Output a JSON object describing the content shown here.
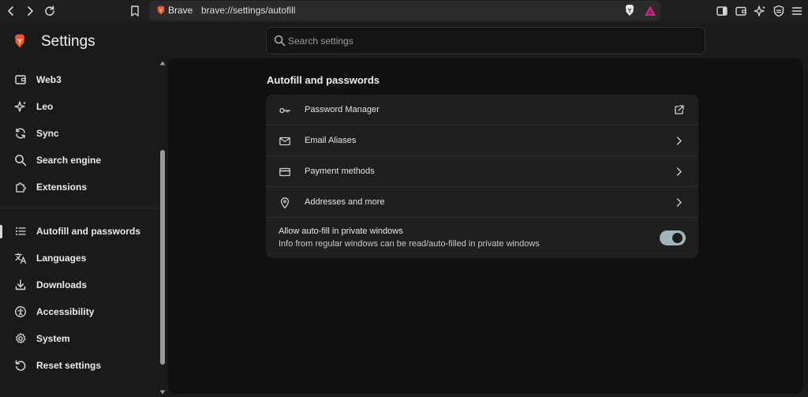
{
  "browser": {
    "site_name": "Brave",
    "url": "brave://settings/autofill"
  },
  "app": {
    "title": "Settings"
  },
  "search": {
    "placeholder": "Search settings",
    "value": ""
  },
  "sidebar": {
    "items": [
      {
        "label": "Web3",
        "icon": "wallet-icon"
      },
      {
        "label": "Leo",
        "icon": "leo-sparkle-icon"
      },
      {
        "label": "Sync",
        "icon": "sync-icon"
      },
      {
        "label": "Search engine",
        "icon": "search-icon"
      },
      {
        "label": "Extensions",
        "icon": "puzzle-icon"
      },
      {
        "label": "Autofill and passwords",
        "icon": "list-icon",
        "active": true
      },
      {
        "label": "Languages",
        "icon": "translate-icon"
      },
      {
        "label": "Downloads",
        "icon": "download-icon"
      },
      {
        "label": "Accessibility",
        "icon": "accessibility-icon"
      },
      {
        "label": "System",
        "icon": "gear-icon"
      },
      {
        "label": "Reset settings",
        "icon": "reset-icon"
      }
    ]
  },
  "main": {
    "section_title": "Autofill and passwords",
    "rows": [
      {
        "label": "Password Manager",
        "icon": "key-icon",
        "trail": "external-link-icon"
      },
      {
        "label": "Email Aliases",
        "icon": "mail-icon",
        "trail": "chevron-right-icon"
      },
      {
        "label": "Payment methods",
        "icon": "credit-card-icon",
        "trail": "chevron-right-icon"
      },
      {
        "label": "Addresses and more",
        "icon": "location-pin-icon",
        "trail": "chevron-right-icon"
      }
    ],
    "private_autofill": {
      "title": "Allow auto-fill in private windows",
      "subtitle": "Info from regular windows can be read/auto-filled in private windows",
      "enabled": true
    }
  },
  "colors": {
    "brand": "#fb542b",
    "toggle_on": "#9fb6bc",
    "background": "#1a1a1a"
  }
}
